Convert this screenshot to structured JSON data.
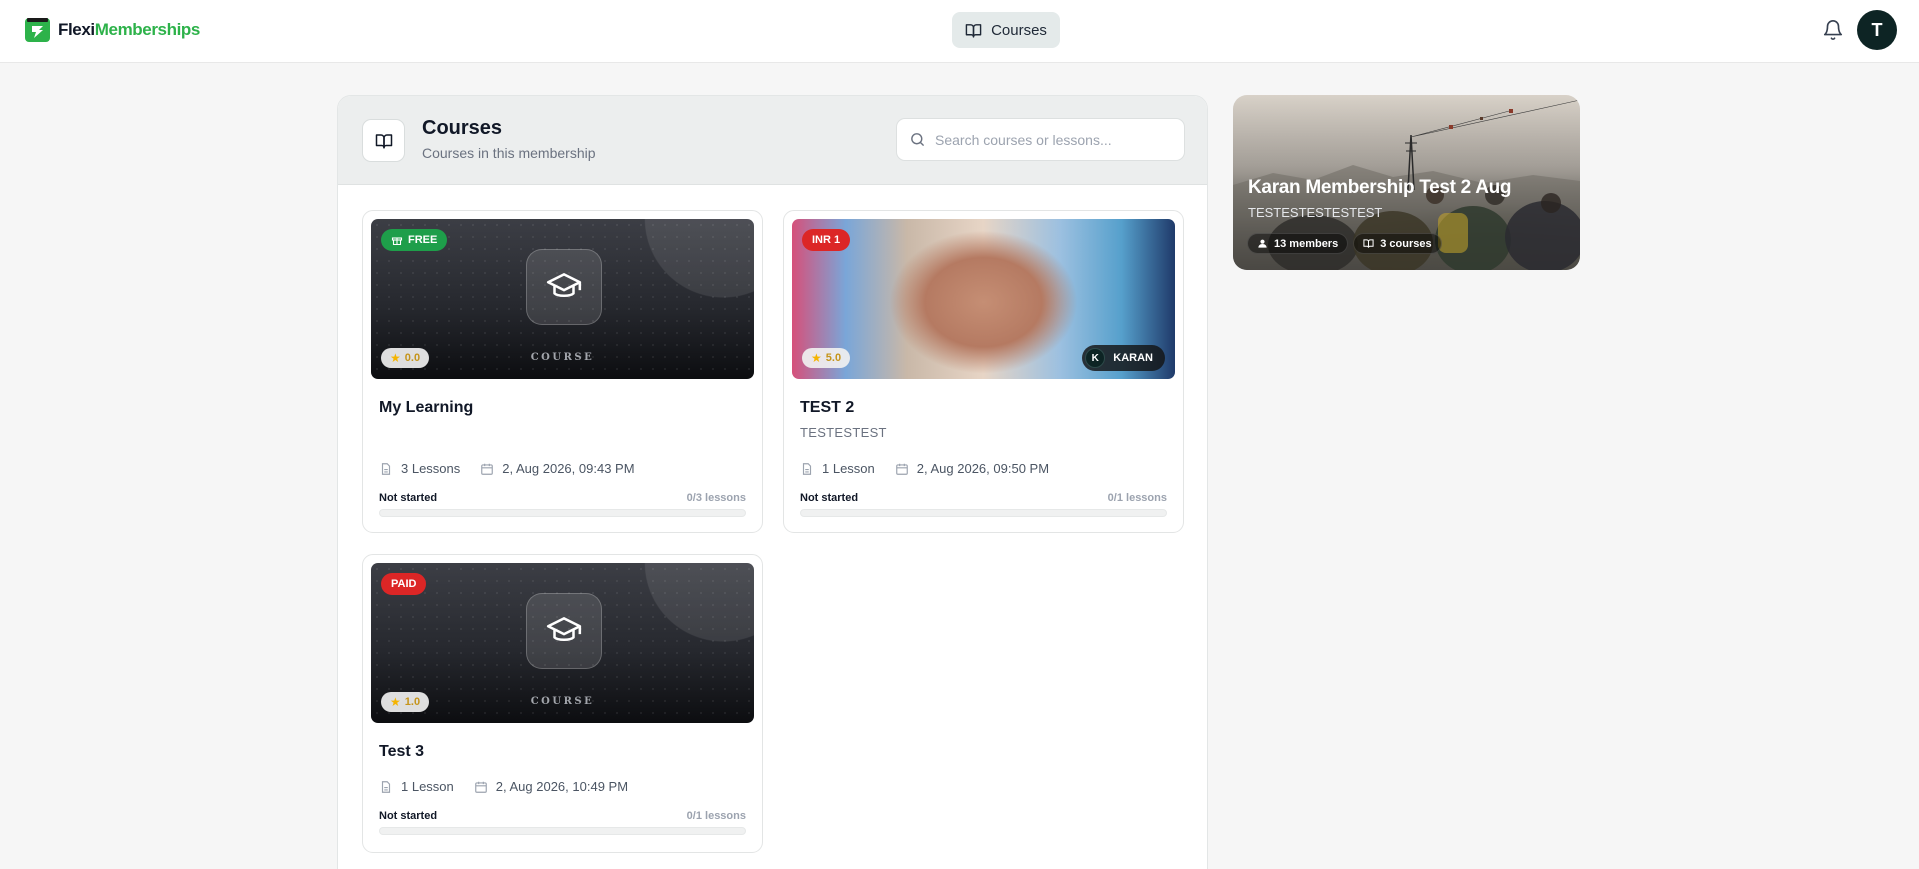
{
  "brand": {
    "name_part1": "Flexi",
    "name_part2": "Memberships"
  },
  "nav": {
    "courses_tab": "Courses"
  },
  "user": {
    "avatar_initial": "T"
  },
  "panel": {
    "title": "Courses",
    "subtitle": "Courses in this membership",
    "search_placeholder": "Search courses or lessons..."
  },
  "courses": [
    {
      "badge": "FREE",
      "rating": "0.0",
      "thumb_label": "COURSE",
      "title": "My Learning",
      "subtitle": "",
      "lessons_count": "3 Lessons",
      "date": "2, Aug 2026, 09:43 PM",
      "status": "Not started",
      "progress_text": "0/3 lessons",
      "progress": 0
    },
    {
      "badge": "INR 1",
      "rating": "5.0",
      "author_initial": "K",
      "author_name": "KARAN",
      "title": "TEST 2",
      "subtitle": "TESTESTEST",
      "lessons_count": "1 Lesson",
      "date": "2, Aug 2026, 09:50 PM",
      "status": "Not started",
      "progress_text": "0/1 lessons",
      "progress": 0
    },
    {
      "badge": "PAID",
      "rating": "1.0",
      "thumb_label": "COURSE",
      "title": "Test 3",
      "subtitle": "",
      "lessons_count": "1 Lesson",
      "date": "2, Aug 2026, 10:49 PM",
      "status": "Not started",
      "progress_text": "0/1 lessons",
      "progress": 0
    }
  ],
  "membership": {
    "title": "Karan Membership Test 2 Aug",
    "subtitle": "TESTESTESTESTEST",
    "members": "13 members",
    "courses": "3 courses"
  },
  "colors": {
    "brand_green": "#2db24a",
    "free_badge": "#1e9e4a",
    "paid_badge": "#dc2626",
    "avatar_bg": "#0d2424"
  },
  "icons": [
    "logo-icon",
    "book-open-icon",
    "bell-icon",
    "search-icon",
    "graduation-cap-icon",
    "gift-icon",
    "star-icon",
    "file-icon",
    "calendar-icon",
    "user-icon"
  ]
}
